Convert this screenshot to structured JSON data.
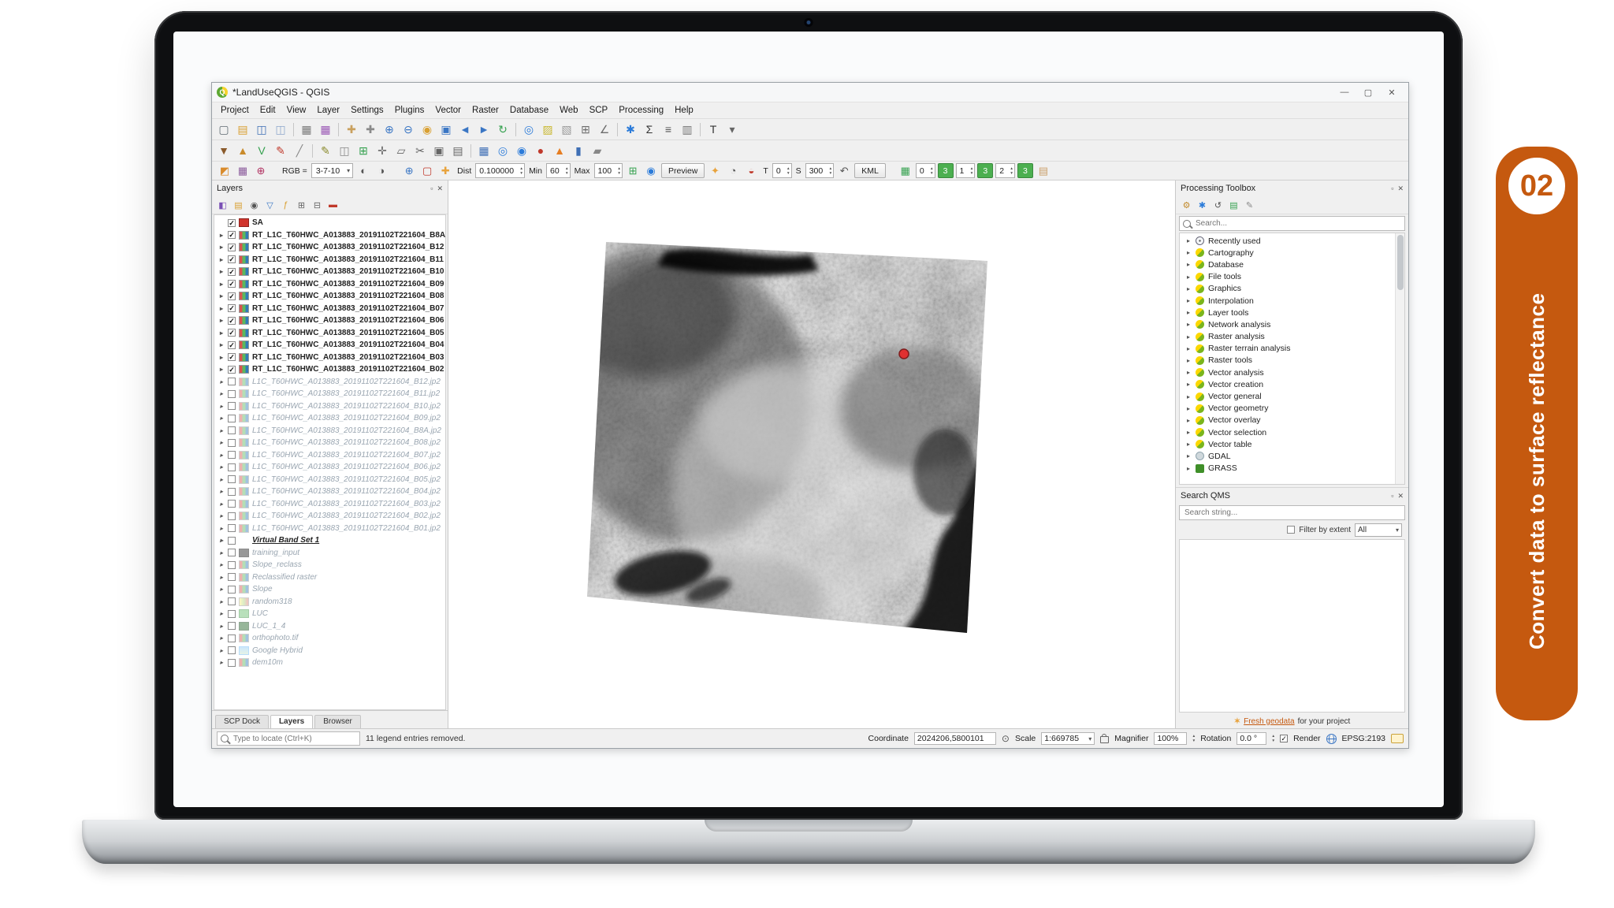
{
  "badge": {
    "number": "02",
    "label": "Convert data to surface reflectance",
    "color": "#c5590f"
  },
  "window": {
    "title": "*LandUseQGIS - QGIS",
    "minimize": "—",
    "maximize": "▢",
    "close": "✕"
  },
  "menubar": [
    "Project",
    "Edit",
    "View",
    "Layer",
    "Settings",
    "Plugins",
    "Vector",
    "Raster",
    "Database",
    "Web",
    "SCP",
    "Processing",
    "Help"
  ],
  "toolbar_main": [
    {
      "n": "project-new-icon",
      "g": "▢",
      "c": "#5f6a72"
    },
    {
      "n": "project-open-icon",
      "g": "▤",
      "c": "#d9a032"
    },
    {
      "n": "project-save-icon",
      "g": "◫",
      "c": "#3f6fb5"
    },
    {
      "n": "project-save-as-icon",
      "g": "◫",
      "c": "#8fa8cc"
    },
    {
      "cls": "sep"
    },
    {
      "n": "new-layout-icon",
      "g": "▦",
      "c": "#7a7a7a"
    },
    {
      "n": "layout-manager-icon",
      "g": "▦",
      "c": "#9b59b6"
    },
    {
      "cls": "sep"
    },
    {
      "n": "pan-map-icon",
      "g": "✚",
      "c": "#c9a05e"
    },
    {
      "n": "pan-to-selection-icon",
      "g": "✚",
      "c": "#8a8a8a"
    },
    {
      "n": "zoom-in-icon",
      "g": "⊕",
      "c": "#3a76c4"
    },
    {
      "n": "zoom-out-icon",
      "g": "⊖",
      "c": "#3a76c4"
    },
    {
      "n": "zoom-full-icon",
      "g": "◉",
      "c": "#d9a032"
    },
    {
      "n": "zoom-to-layer-icon",
      "g": "▣",
      "c": "#3a76c4"
    },
    {
      "n": "zoom-last-icon",
      "g": "◄",
      "c": "#3a76c4"
    },
    {
      "n": "zoom-next-icon",
      "g": "►",
      "c": "#3a76c4"
    },
    {
      "n": "refresh-icon",
      "g": "↻",
      "c": "#35a14f"
    },
    {
      "cls": "sep"
    },
    {
      "n": "identify-icon",
      "g": "◎",
      "c": "#2b7bd9"
    },
    {
      "n": "select-features-icon",
      "g": "▨",
      "c": "#c9b832"
    },
    {
      "n": "deselect-icon",
      "g": "▧",
      "c": "#9a9a9a"
    },
    {
      "n": "open-attribute-table-icon",
      "g": "⊞",
      "c": "#6d6d6d"
    },
    {
      "n": "measure-icon",
      "g": "∠",
      "c": "#6d6d6d"
    },
    {
      "cls": "sep"
    },
    {
      "n": "processing-toolbox-icon",
      "g": "✱",
      "c": "#2b7bd9"
    },
    {
      "n": "statistics-icon",
      "g": "Σ",
      "c": "#333333"
    },
    {
      "n": "show-statistical-summary-icon",
      "g": "≡",
      "c": "#555555"
    },
    {
      "n": "options-icon",
      "g": "▥",
      "c": "#777777"
    },
    {
      "cls": "sep"
    },
    {
      "n": "text-annotation-icon",
      "g": "T",
      "c": "#333333"
    },
    {
      "n": "annotation-dropdown-icon",
      "g": "▾",
      "c": "#666666"
    }
  ],
  "toolbar_plugins": [
    {
      "n": "scp-download-products-icon",
      "g": "▼",
      "c": "#8a5a2b"
    },
    {
      "n": "scp-band-tools-icon",
      "g": "▲",
      "c": "#c98b2b"
    },
    {
      "n": "scp-vector-icon",
      "g": "V",
      "c": "#35a14f"
    },
    {
      "n": "scp-pencil-icon",
      "g": "✎",
      "c": "#c0392b"
    },
    {
      "n": "scp-slash-icon",
      "g": "╱",
      "c": "#888888"
    },
    {
      "cls": "sep"
    },
    {
      "n": "toggle-editing-icon",
      "g": "✎",
      "c": "#8a8a2b"
    },
    {
      "n": "save-edits-icon",
      "g": "◫",
      "c": "#8a8a8a"
    },
    {
      "n": "add-feature-icon",
      "g": "⊞",
      "c": "#35a14f"
    },
    {
      "n": "move-feature-icon",
      "g": "✛",
      "c": "#666666"
    },
    {
      "n": "vertex-tool-icon",
      "g": "▱",
      "c": "#666666"
    },
    {
      "n": "cut-features-icon",
      "g": "✂",
      "c": "#666666"
    },
    {
      "n": "copy-features-icon",
      "g": "▣",
      "c": "#666666"
    },
    {
      "n": "paste-features-icon",
      "g": "▤",
      "c": "#666666"
    },
    {
      "cls": "sep"
    },
    {
      "n": "raster-stack-icon",
      "g": "▦",
      "c": "#3f6fb5"
    },
    {
      "n": "zoom-native-resolution-icon",
      "g": "◎",
      "c": "#2b7bd9"
    },
    {
      "n": "magnifier-icon",
      "g": "◉",
      "c": "#2b7bd9"
    },
    {
      "n": "osm-place-search-icon",
      "g": "●",
      "c": "#c0392b"
    },
    {
      "n": "flame-icon",
      "g": "▲",
      "c": "#e67e22"
    },
    {
      "n": "blue-panel-icon",
      "g": "▮",
      "c": "#3f6fb5"
    },
    {
      "n": "help-contents-icon",
      "g": "▰",
      "c": "#888888"
    }
  ],
  "scp_toolbar": [
    {
      "cls": "tk-icon",
      "n": "scp-plugin-icon",
      "x": "◩",
      "c": "#d98b2b"
    },
    {
      "cls": "tk-icon",
      "n": "scp-bandset-icon",
      "x": "▦",
      "c": "#8a5a9b"
    },
    {
      "cls": "tk-icon",
      "n": "scp-image-search-icon",
      "x": "⊕",
      "c": "#b03060"
    },
    {
      "cls": "tk-gap"
    },
    {
      "cls": "tk-label",
      "n": "rgb-label",
      "x": "RGB ="
    },
    {
      "cls": "tk-combo",
      "n": "rgb-combo",
      "x": "3-7-10"
    },
    {
      "cls": "tk-icon",
      "n": "cumulative-cut-stretch-icon",
      "x": "◐",
      "c": "#555555"
    },
    {
      "cls": "tk-icon",
      "n": "std-deviation-stretch-icon",
      "x": "◑",
      "c": "#555555"
    },
    {
      "cls": "tk-gap"
    },
    {
      "cls": "tk-icon",
      "n": "zoom-to-roi-icon",
      "x": "⊕",
      "c": "#3a76c4"
    },
    {
      "cls": "tk-icon",
      "n": "roi-polygon-icon",
      "x": "▢",
      "c": "#c0392b"
    },
    {
      "cls": "tk-icon",
      "n": "roi-pointer-icon",
      "x": "✚",
      "c": "#e8a33d"
    },
    {
      "cls": "tk-label",
      "n": "dist-label",
      "x": "Dist"
    },
    {
      "cls": "tk-spin",
      "n": "dist-spinbox",
      "x": "0.100000"
    },
    {
      "cls": "tk-label",
      "n": "min-label",
      "x": "Min"
    },
    {
      "cls": "tk-spin",
      "n": "min-spinbox",
      "x": "60"
    },
    {
      "cls": "tk-label",
      "n": "max-label",
      "x": "Max"
    },
    {
      "cls": "tk-spin",
      "n": "max-spinbox",
      "x": "100"
    },
    {
      "cls": "tk-icon",
      "n": "preview-plus-icon",
      "x": "⊞",
      "c": "#35a14f"
    },
    {
      "cls": "tk-icon",
      "n": "preview-pointer-icon",
      "x": "◉",
      "c": "#2b7bd9"
    },
    {
      "cls": "tk-button",
      "n": "preview-button",
      "x": "Preview"
    },
    {
      "cls": "tk-icon",
      "n": "lightning-icon",
      "x": "✦",
      "c": "#e8a33d"
    },
    {
      "cls": "tk-icon",
      "n": "transparency-icon",
      "x": "◔",
      "c": "#555555"
    },
    {
      "cls": "tk-icon",
      "n": "rgb-dots-icon",
      "x": "◒",
      "c": "#c0392b"
    },
    {
      "cls": "tk-label",
      "n": "t-label",
      "x": "T"
    },
    {
      "cls": "tk-spin",
      "n": "t-spinbox",
      "x": "0"
    },
    {
      "cls": "tk-label",
      "n": "s-label",
      "x": "S"
    },
    {
      "cls": "tk-spin",
      "n": "s-spinbox",
      "x": "300"
    },
    {
      "cls": "tk-icon",
      "n": "undo-icon",
      "x": "↶",
      "c": "#555555"
    },
    {
      "cls": "tk-button",
      "n": "kml-button",
      "x": "KML"
    },
    {
      "cls": "tk-gap"
    },
    {
      "cls": "tk-icon",
      "n": "grid-icon",
      "x": "▦",
      "c": "#35a14f"
    },
    {
      "cls": "tk-spin",
      "n": "band0-spinbox",
      "x": "0"
    },
    {
      "cls": "tk-button green",
      "n": "band0-button",
      "x": "3"
    },
    {
      "cls": "tk-spin",
      "n": "band1-spinbox",
      "x": "1"
    },
    {
      "cls": "tk-button green",
      "n": "band1-button",
      "x": "3"
    },
    {
      "cls": "tk-spin",
      "n": "band2-spinbox",
      "x": "2"
    },
    {
      "cls": "tk-button green",
      "n": "band2-button",
      "x": "3"
    },
    {
      "cls": "tk-icon",
      "n": "sheet-icon",
      "x": "▤",
      "c": "#caa06a"
    }
  ],
  "layers_panel": {
    "title": "Layers",
    "toolbar": [
      {
        "n": "layer-styling-icon",
        "g": "◧",
        "c": "#7a4fb5"
      },
      {
        "n": "add-group-icon",
        "g": "▤",
        "c": "#d9a032"
      },
      {
        "n": "map-themes-icon",
        "g": "◉",
        "c": "#555555"
      },
      {
        "n": "filter-legend-icon",
        "g": "▽",
        "c": "#3a76c4"
      },
      {
        "n": "filter-expression-icon",
        "g": "ƒ",
        "c": "#d9a032"
      },
      {
        "n": "expand-all-icon",
        "g": "⊞",
        "c": "#666666"
      },
      {
        "n": "collapse-all-icon",
        "g": "⊟",
        "c": "#666666"
      },
      {
        "n": "remove-layer-icon",
        "g": "▬",
        "c": "#c0392b"
      }
    ],
    "items": [
      {
        "label": "SA",
        "cls": "row-on",
        "chk": "cb-on",
        "icon": "li-red",
        "exp": ""
      },
      {
        "label": "RT_L1C_T60HWC_A013883_20191102T221604_B8A",
        "cls": "row-on",
        "chk": "cb-on",
        "icon": "li-raster",
        "exp": "has"
      },
      {
        "label": "RT_L1C_T60HWC_A013883_20191102T221604_B12",
        "cls": "row-on",
        "chk": "cb-on",
        "icon": "li-raster",
        "exp": "has"
      },
      {
        "label": "RT_L1C_T60HWC_A013883_20191102T221604_B11",
        "cls": "row-on",
        "chk": "cb-on",
        "icon": "li-raster",
        "exp": "has"
      },
      {
        "label": "RT_L1C_T60HWC_A013883_20191102T221604_B10",
        "cls": "row-on",
        "chk": "cb-on",
        "icon": "li-raster",
        "exp": "has"
      },
      {
        "label": "RT_L1C_T60HWC_A013883_20191102T221604_B09",
        "cls": "row-on",
        "chk": "cb-on",
        "icon": "li-raster",
        "exp": "has"
      },
      {
        "label": "RT_L1C_T60HWC_A013883_20191102T221604_B08",
        "cls": "row-on",
        "chk": "cb-on",
        "icon": "li-raster",
        "exp": "has"
      },
      {
        "label": "RT_L1C_T60HWC_A013883_20191102T221604_B07",
        "cls": "row-on",
        "chk": "cb-on",
        "icon": "li-raster",
        "exp": "has"
      },
      {
        "label": "RT_L1C_T60HWC_A013883_20191102T221604_B06",
        "cls": "row-on",
        "chk": "cb-on",
        "icon": "li-raster",
        "exp": "has"
      },
      {
        "label": "RT_L1C_T60HWC_A013883_20191102T221604_B05",
        "cls": "row-on",
        "chk": "cb-on",
        "icon": "li-raster",
        "exp": "has"
      },
      {
        "label": "RT_L1C_T60HWC_A013883_20191102T221604_B04",
        "cls": "row-on",
        "chk": "cb-on",
        "icon": "li-raster",
        "exp": "has"
      },
      {
        "label": "RT_L1C_T60HWC_A013883_20191102T221604_B03",
        "cls": "row-on",
        "chk": "cb-on",
        "icon": "li-raster",
        "exp": "has"
      },
      {
        "label": "RT_L1C_T60HWC_A013883_20191102T221604_B02",
        "cls": "row-on",
        "chk": "cb-on",
        "icon": "li-raster",
        "exp": "has"
      },
      {
        "label": "L1C_T60HWC_A013883_20191102T221604_B12.jp2",
        "cls": "row-off",
        "chk": "cb-off",
        "icon": "li-raster",
        "exp": "has"
      },
      {
        "label": "L1C_T60HWC_A013883_20191102T221604_B11.jp2",
        "cls": "row-off",
        "chk": "cb-off",
        "icon": "li-raster",
        "exp": "has"
      },
      {
        "label": "L1C_T60HWC_A013883_20191102T221604_B10.jp2",
        "cls": "row-off",
        "chk": "cb-off",
        "icon": "li-raster",
        "exp": "has"
      },
      {
        "label": "L1C_T60HWC_A013883_20191102T221604_B09.jp2",
        "cls": "row-off",
        "chk": "cb-off",
        "icon": "li-raster",
        "exp": "has"
      },
      {
        "label": "L1C_T60HWC_A013883_20191102T221604_B8A.jp2",
        "cls": "row-off",
        "chk": "cb-off",
        "icon": "li-raster",
        "exp": "has"
      },
      {
        "label": "L1C_T60HWC_A013883_20191102T221604_B08.jp2",
        "cls": "row-off",
        "chk": "cb-off",
        "icon": "li-raster",
        "exp": "has"
      },
      {
        "label": "L1C_T60HWC_A013883_20191102T221604_B07.jp2",
        "cls": "row-off",
        "chk": "cb-off",
        "icon": "li-raster",
        "exp": "has"
      },
      {
        "label": "L1C_T60HWC_A013883_20191102T221604_B06.jp2",
        "cls": "row-off",
        "chk": "cb-off",
        "icon": "li-raster",
        "exp": "has"
      },
      {
        "label": "L1C_T60HWC_A013883_20191102T221604_B05.jp2",
        "cls": "row-off",
        "chk": "cb-off",
        "icon": "li-raster",
        "exp": "has"
      },
      {
        "label": "L1C_T60HWC_A013883_20191102T221604_B04.jp2",
        "cls": "row-off",
        "chk": "cb-off",
        "icon": "li-raster",
        "exp": "has"
      },
      {
        "label": "L1C_T60HWC_A013883_20191102T221604_B03.jp2",
        "cls": "row-off",
        "chk": "cb-off",
        "icon": "li-raster",
        "exp": "has"
      },
      {
        "label": "L1C_T60HWC_A013883_20191102T221604_B02.jp2",
        "cls": "row-off",
        "chk": "cb-off",
        "icon": "li-raster",
        "exp": "has"
      },
      {
        "label": "L1C_T60HWC_A013883_20191102T221604_B01.jp2",
        "cls": "row-off",
        "chk": "cb-off",
        "icon": "li-raster",
        "exp": "has"
      },
      {
        "label": "Virtual Band Set 1",
        "cls": "row-vbs",
        "chk": "cb-off",
        "icon": "li-none",
        "exp": "has"
      },
      {
        "label": "training_input",
        "cls": "row-off",
        "chk": "cb-off",
        "icon": "li-black",
        "exp": "has"
      },
      {
        "label": "Slope_reclass",
        "cls": "row-off",
        "chk": "cb-off",
        "icon": "li-raster",
        "exp": "has"
      },
      {
        "label": "Reclassified raster",
        "cls": "row-off",
        "chk": "cb-off",
        "icon": "li-raster",
        "exp": "has"
      },
      {
        "label": "Slope",
        "cls": "row-off",
        "chk": "cb-off",
        "icon": "li-raster",
        "exp": "has"
      },
      {
        "label": "random318",
        "cls": "row-off",
        "chk": "cb-off",
        "icon": "li-grad",
        "exp": "has"
      },
      {
        "label": "LUC",
        "cls": "row-off",
        "chk": "cb-off",
        "icon": "li-green",
        "exp": "has"
      },
      {
        "label": "LUC_1_4",
        "cls": "row-off",
        "chk": "cb-off",
        "icon": "li-dgreen",
        "exp": "has"
      },
      {
        "label": "orthophoto.tif",
        "cls": "row-off",
        "chk": "cb-off",
        "icon": "li-raster",
        "exp": "has"
      },
      {
        "label": "Google Hybrid",
        "cls": "row-off",
        "chk": "cb-off",
        "icon": "li-web",
        "exp": "has"
      },
      {
        "label": "dem10m",
        "cls": "row-off",
        "chk": "cb-off",
        "icon": "li-raster",
        "exp": "has"
      }
    ],
    "tabs": [
      {
        "label": "SCP Dock",
        "cls": ""
      },
      {
        "label": "Layers",
        "cls": "active"
      },
      {
        "label": "Browser",
        "cls": ""
      }
    ]
  },
  "map": {
    "marker_color": "#e03131"
  },
  "processing_panel": {
    "title": "Processing Toolbox",
    "toolbar": [
      {
        "n": "proc-wrench-icon",
        "g": "⚙",
        "c": "#c28a2b"
      },
      {
        "n": "proc-model-icon",
        "g": "✱",
        "c": "#2b7bd9"
      },
      {
        "n": "proc-history-icon",
        "g": "↺",
        "c": "#555555"
      },
      {
        "n": "proc-results-icon",
        "g": "▤",
        "c": "#35a14f"
      },
      {
        "n": "proc-edit-in-place-icon",
        "g": "✎",
        "c": "#888888"
      }
    ],
    "search_placeholder": "Search...",
    "categories": [
      {
        "label": "Recently used",
        "icon": "ic-clock"
      },
      {
        "label": "Cartography",
        "icon": "ic-q"
      },
      {
        "label": "Database",
        "icon": "ic-q"
      },
      {
        "label": "File tools",
        "icon": "ic-q"
      },
      {
        "label": "Graphics",
        "icon": "ic-q"
      },
      {
        "label": "Interpolation",
        "icon": "ic-q"
      },
      {
        "label": "Layer tools",
        "icon": "ic-q"
      },
      {
        "label": "Network analysis",
        "icon": "ic-q"
      },
      {
        "label": "Raster analysis",
        "icon": "ic-q"
      },
      {
        "label": "Raster terrain analysis",
        "icon": "ic-q"
      },
      {
        "label": "Raster tools",
        "icon": "ic-q"
      },
      {
        "label": "Vector analysis",
        "icon": "ic-q"
      },
      {
        "label": "Vector creation",
        "icon": "ic-q"
      },
      {
        "label": "Vector general",
        "icon": "ic-q"
      },
      {
        "label": "Vector geometry",
        "icon": "ic-q"
      },
      {
        "label": "Vector overlay",
        "icon": "ic-q"
      },
      {
        "label": "Vector selection",
        "icon": "ic-q"
      },
      {
        "label": "Vector table",
        "icon": "ic-q"
      },
      {
        "label": "GDAL",
        "icon": "ic-gdal"
      },
      {
        "label": "GRASS",
        "icon": "ic-grass"
      }
    ]
  },
  "qms_panel": {
    "title": "Search QMS",
    "search_placeholder": "Search string...",
    "filter_label": "Filter by extent",
    "filter_all": "All",
    "footer_link": "Fresh geodata",
    "footer_rest": "for your project"
  },
  "statusbar": {
    "locate_placeholder": "Type to locate (Ctrl+K)",
    "message": "11 legend entries removed.",
    "coordinate_label": "Coordinate",
    "coordinate_value": "2024206,5800101",
    "scale_label": "Scale",
    "scale_value": "1:669785",
    "magnifier_label": "Magnifier",
    "magnifier_value": "100%",
    "rotation_label": "Rotation",
    "rotation_value": "0.0 °",
    "render_label": "Render",
    "crs": "EPSG:2193"
  }
}
